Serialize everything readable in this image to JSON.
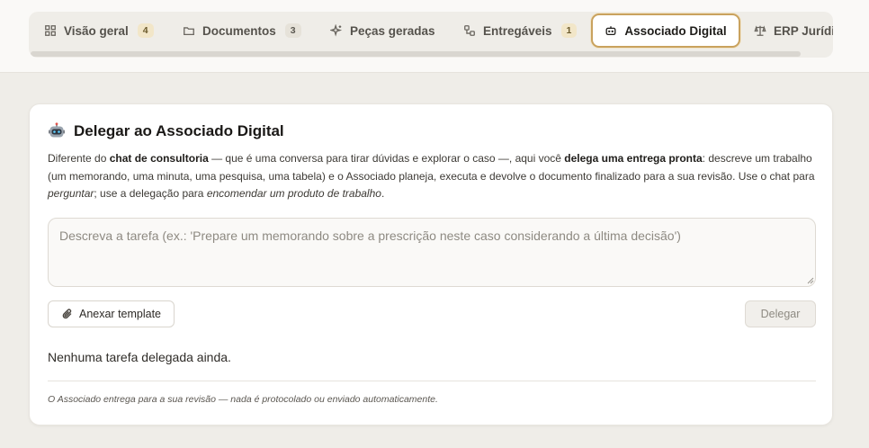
{
  "tabs": [
    {
      "label": "Visão geral",
      "count": "4",
      "icon": "grid-icon"
    },
    {
      "label": "Documentos",
      "count": "3",
      "icon": "folder-icon"
    },
    {
      "label": "Peças geradas",
      "count": "",
      "icon": "sparkles-icon"
    },
    {
      "label": "Entregáveis",
      "count": "1",
      "icon": "workflow-icon"
    },
    {
      "label": "Associado Digital",
      "count": "",
      "icon": "robot-icon",
      "active": true
    },
    {
      "label": "ERP Jurídi",
      "count": "",
      "icon": "scale-icon"
    }
  ],
  "panel": {
    "title": "Delegar ao Associado Digital",
    "title_icon": "robot-icon",
    "description": {
      "p1": "Diferente do ",
      "b1": "chat de consultoria",
      "p2": " — que é uma conversa para tirar dúvidas e explorar o caso —, aqui você ",
      "b2": "delega uma entrega pronta",
      "p3": ": descreve um trabalho (um memorando, uma minuta, uma pesquisa, uma tabela) e o Associado planeja, executa e devolve o documento finalizado para a sua revisão. Use o chat para ",
      "i1": "perguntar",
      "p4": "; use a delegação para ",
      "i2": "encomendar um produto de trabalho",
      "p5": "."
    },
    "task_placeholder": "Descreva a tarefa (ex.: 'Prepare um memorando sobre a prescrição neste caso considerando a última decisão')",
    "task_value": "",
    "attach_label": "Anexar template",
    "attach_icon": "paperclip-icon",
    "delegate_label": "Delegar",
    "empty_state": "Nenhuma tarefa delegada ainda.",
    "footnote": "O Associado entrega para a sua revisão — nada é protocolado ou enviado automaticamente."
  },
  "colors": {
    "accent_border": "#c9a25e",
    "page_bg": "#efede8",
    "card_bg": "#ffffff"
  }
}
